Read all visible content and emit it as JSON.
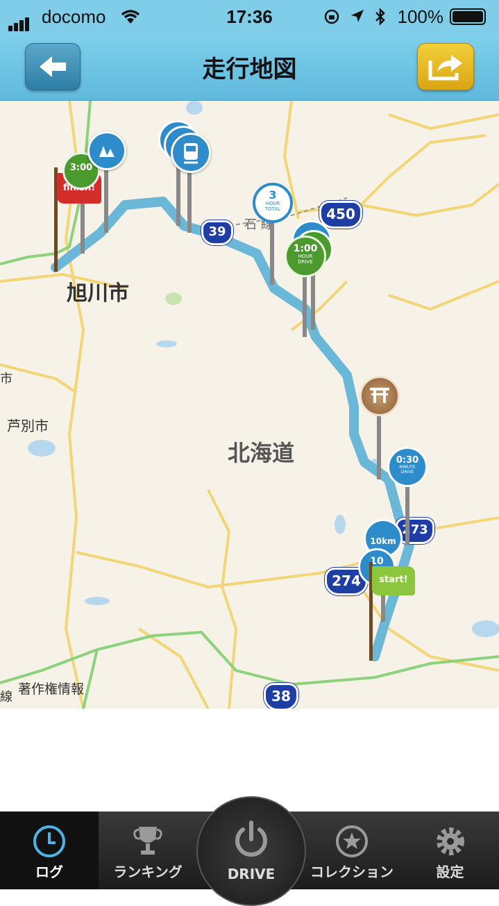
{
  "status_bar": {
    "carrier": "docomo",
    "time": "17:36",
    "battery": "100%"
  },
  "nav": {
    "title": "走行地図",
    "back_icon": "arrow-left-icon",
    "share_icon": "share-arrow-icon"
  },
  "map": {
    "place_labels": {
      "asahikawa": "旭川市",
      "hokkaido": "北海道",
      "ashibetsu": "芦別市",
      "copyright": "著作権情報",
      "rail_line": "石 線",
      "edge_left_1": "市",
      "edge_left_2": "線"
    },
    "road_shields": {
      "r450": "450",
      "r274": "274",
      "r38": "38",
      "r39": "39",
      "r273": "273"
    },
    "markers": {
      "start": "start!",
      "finish": "finish!",
      "three_hour_total": "3",
      "three_hour_total_sub": "HOUR TOTAL",
      "one_hour_drive": "1:00",
      "one_hour_drive_sub": "HOUR DRIVE",
      "thirty_min_drive": "0:30",
      "thirty_min_drive_sub": "MINUTE DRIVE",
      "finish_time": "3:00",
      "ten_km": "10km",
      "ten": "10"
    }
  },
  "tabs": [
    {
      "label": "ログ",
      "icon": "clock-icon",
      "active": true
    },
    {
      "label": "ランキング",
      "icon": "trophy-icon",
      "active": false
    },
    {
      "label": "DRIVE",
      "icon": "power-icon",
      "active": false
    },
    {
      "label": "コレクション",
      "icon": "star-icon",
      "active": false
    },
    {
      "label": "設定",
      "icon": "gear-icon",
      "active": false
    }
  ]
}
